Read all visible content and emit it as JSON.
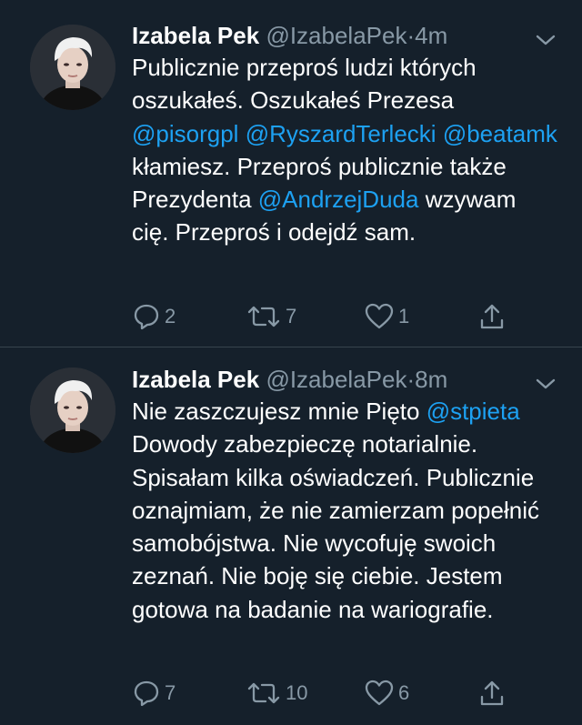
{
  "tweets": [
    {
      "author_name": "Izabela Pek",
      "handle": "@IzabelaPek",
      "dot": "·",
      "time": "4m",
      "body": [
        {
          "t": "Publicznie przeproś ludzi których oszukałeś. Oszukałeś Prezesa "
        },
        {
          "m": "@pisorgpl"
        },
        {
          "t": " "
        },
        {
          "m": "@RyszardTerlecki"
        },
        {
          "t": " "
        },
        {
          "m": "@beatamk"
        },
        {
          "t": " kłamiesz. Przeproś publicznie także Prezydenta "
        },
        {
          "m": "@AndrzejDuda"
        },
        {
          "t": " wzywam cię. Przeproś i odejdź sam."
        }
      ],
      "reply_count": "2",
      "retweet_count": "7",
      "like_count": "1"
    },
    {
      "author_name": "Izabela Pek",
      "handle": "@IzabelaPek",
      "dot": "·",
      "time": "8m",
      "body": [
        {
          "t": "Nie zaszczujesz mnie Pięto "
        },
        {
          "m": "@stpieta"
        },
        {
          "t": " Dowody zabezpieczę notarialnie. Spisałam kilka oświadczeń. Publicznie oznajmiam, że nie zamierzam popełnić samobójstwa. Nie wycofuję swoich zeznań. Nie boję się ciebie. Jestem gotowa na badanie na wariografie."
        }
      ],
      "reply_count": "7",
      "retweet_count": "10",
      "like_count": "6"
    }
  ],
  "icons": {
    "reply": "reply-icon",
    "retweet": "retweet-icon",
    "like": "heart-icon",
    "share": "share-icon",
    "caret": "chevron-down-icon"
  },
  "colors": {
    "background": "#15202b",
    "text": "#ffffff",
    "secondary": "#8899a6",
    "link": "#1da1f2",
    "divider": "#38444d"
  }
}
